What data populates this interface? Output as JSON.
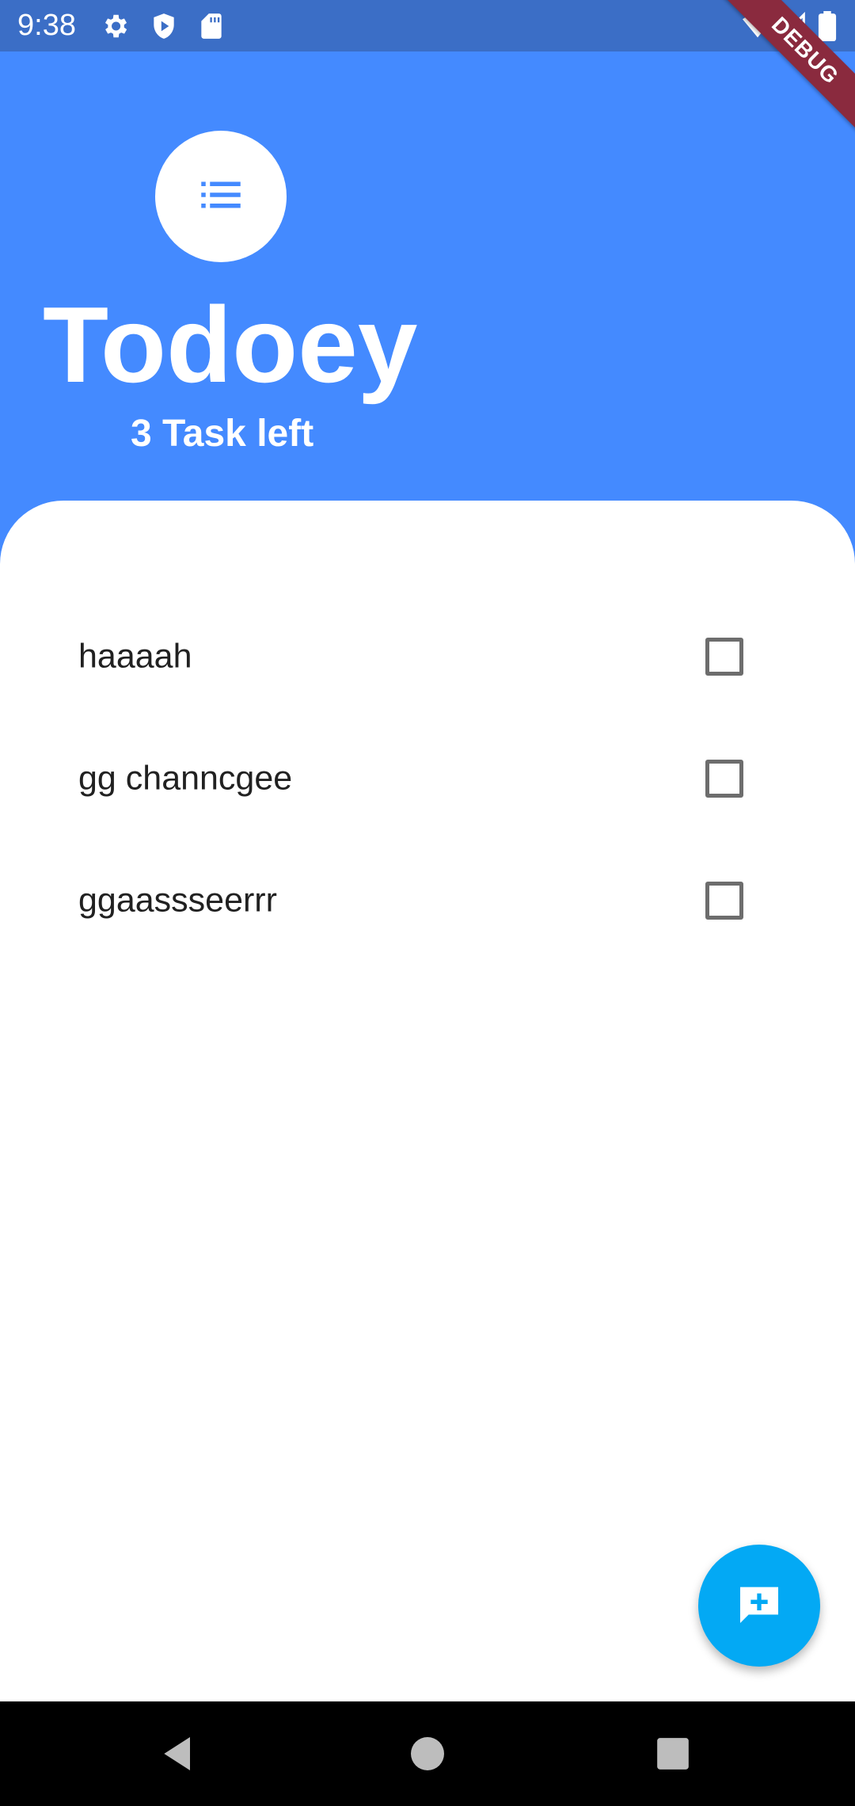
{
  "status_bar": {
    "time": "9:38",
    "icons": [
      "settings-icon",
      "play-protect-icon",
      "sd-card-icon",
      "wifi-icon",
      "signal-icon",
      "battery-icon"
    ]
  },
  "debug_banner": {
    "label": "DEBUG"
  },
  "header": {
    "icon": "list-icon",
    "title": "Todoey",
    "subtitle": "3 Task left"
  },
  "tasks": [
    {
      "title": "haaaah",
      "checked": false
    },
    {
      "title": "gg channcgee",
      "checked": false
    },
    {
      "title": "ggaassseerrr",
      "checked": false
    }
  ],
  "fab": {
    "icon": "add-comment-icon"
  },
  "nav_bar": {
    "icons": [
      "back-icon",
      "home-icon",
      "recents-icon"
    ]
  },
  "colors": {
    "header_bg": "#448AFF",
    "status_bar_bg": "#3B6EC6",
    "fab_bg": "#03A9F4",
    "debug_banner_bg": "#8A2A3E"
  }
}
